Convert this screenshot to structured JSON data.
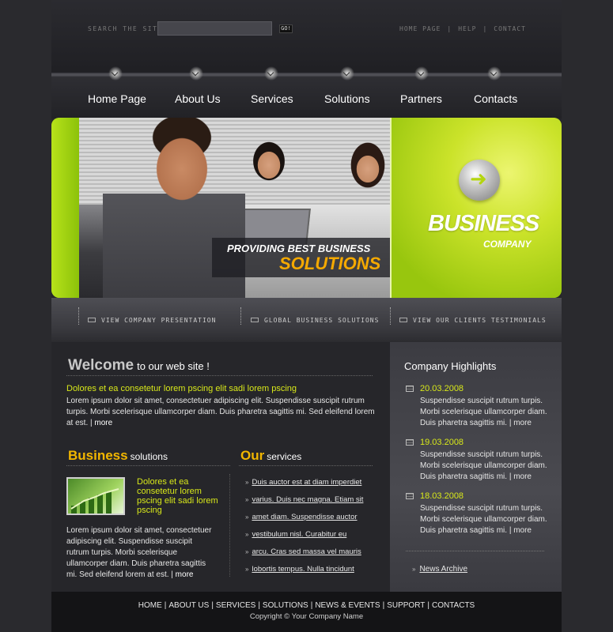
{
  "header": {
    "search_label": "SEARCH THE SITE",
    "search_value": "",
    "go_label": "GO!",
    "top_links": [
      "HOME PAGE",
      "HELP",
      "CONTACT"
    ],
    "top_link_separator": "|"
  },
  "nav": {
    "items": [
      "Home Page",
      "About Us",
      "Services",
      "Solutions",
      "Partners",
      "Contacts"
    ]
  },
  "banner": {
    "caption_line1": "PROVIDING BEST BUSINESS",
    "caption_line2": "SOLUTIONS",
    "brand_line1": "BUSINESS",
    "brand_line2": "COMPANY",
    "accent_color": "#b4d50f",
    "caption_color": "#f5a900"
  },
  "link_bar": {
    "items": [
      "VIEW COMPANY PRESENTATION",
      "GLOBAL BUSINESS SOLUTIONS",
      "VIEW OUR CLIENTS TESTIMONIALS"
    ]
  },
  "welcome": {
    "title_big": "Welcome",
    "title_small": "to our web site !",
    "lead": "Dolores et ea consetetur lorem pscing elit sadi lorem pscing",
    "body": "Lorem ipsum dolor sit amet, consectetuer adipiscing elit. Suspendisse suscipit rutrum turpis. Morbi scelerisque ullamcorper diam. Duis pharetra sagittis mi. Sed eleifend lorem at est.",
    "more_label": "more"
  },
  "business": {
    "title_big": "Business",
    "title_small": "solutions",
    "lead": "Dolores et ea consetetur lorem pscing elit sadi lorem pscing",
    "body": "Lorem ipsum dolor sit amet, consectetuer adipiscing elit. Suspendisse suscipit rutrum turpis. Morbi scelerisque ullamcorper diam. Duis pharetra sagittis mi. Sed eleifend lorem at est.",
    "more_label": "more"
  },
  "services": {
    "title_big": "Our",
    "title_small": "services",
    "bullet": "»",
    "items": [
      "Duis auctor est at diam imperdiet",
      "varius. Duis nec magna. Etiam sit",
      "amet diam. Suspendisse auctor",
      "vestibulum nisl. Curabitur eu",
      "arcu. Cras sed massa vel mauris",
      "lobortis tempus. Nulla tincidunt"
    ]
  },
  "highlights": {
    "title": "Company Highlights",
    "items": [
      {
        "date": "20.03.2008",
        "text": "Suspendisse suscipit rutrum turpis. Morbi scelerisque ullamcorper diam. Duis pharetra sagittis mi.",
        "more_label": "more"
      },
      {
        "date": "19.03.2008",
        "text": "Suspendisse suscipit rutrum turpis. Morbi scelerisque ullamcorper diam. Duis pharetra sagittis mi.",
        "more_label": "more"
      },
      {
        "date": "18.03.2008",
        "text": "Suspendisse suscipit rutrum turpis. Morbi scelerisque ullamcorper diam. Duis pharetra sagittis mi.",
        "more_label": "more"
      }
    ],
    "archive_label": "News Archive",
    "archive_bullet": "»"
  },
  "footer": {
    "links": [
      "HOME",
      "ABOUT US",
      "SERVICES",
      "SOLUTIONS",
      "NEWS & EVENTS",
      "SUPPORT",
      "CONTACTS"
    ],
    "separator": "|",
    "copyright": "Copyright © Your Company Name"
  }
}
